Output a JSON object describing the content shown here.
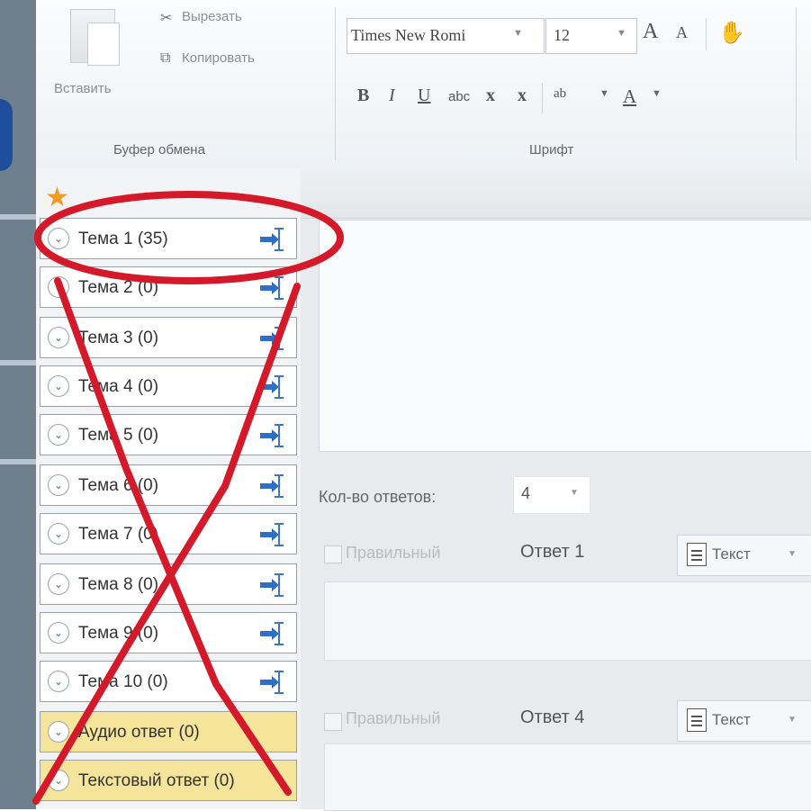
{
  "ribbon": {
    "clipboard": {
      "paste_label": "Вставить",
      "cut_label": "Вырезать",
      "copy_label": "Копировать",
      "group_label": "Буфер обмена"
    },
    "font": {
      "font_name": "Times New Romi",
      "font_size": "12",
      "bold": "B",
      "italic": "I",
      "underline": "U",
      "strike": "abc",
      "subscript": "x",
      "superscript": "x",
      "grow_font": "A",
      "shrink_font": "A",
      "highlight": "ab",
      "font_color": "A",
      "group_label": "Шрифт"
    }
  },
  "themes": [
    {
      "label": "Тема 1 (35)"
    },
    {
      "label": "Тема 2 (0)"
    },
    {
      "label": "Тема 3 (0)"
    },
    {
      "label": "Тема 4 (0)"
    },
    {
      "label": "Тема 5 (0)"
    },
    {
      "label": "Тема 6 (0)"
    },
    {
      "label": "Тема 7 (0)"
    },
    {
      "label": "Тема 8 (0)"
    },
    {
      "label": "Тема 9 (0)"
    },
    {
      "label": "Тема 10 (0)"
    }
  ],
  "special_themes": [
    {
      "label": "Аудио ответ (0)"
    },
    {
      "label": "Текстовый ответ (0)"
    }
  ],
  "answers": {
    "count_label": "Кол-во ответов:",
    "count_value": "4",
    "correct_label": "Правильный",
    "answer1_label": "Ответ 1",
    "answer4_label": "Ответ 4",
    "type_label": "Текст"
  },
  "colors": {
    "annotation_red": "#d3192a",
    "special_theme_yellow": "#f4e59a",
    "accent_blue": "#2d6fc6"
  }
}
